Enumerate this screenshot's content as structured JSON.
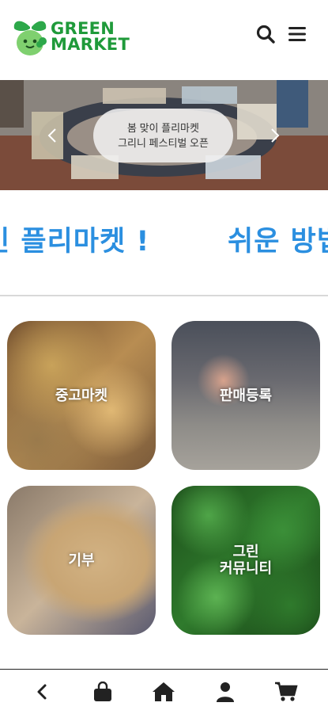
{
  "header": {
    "logo_line1": "GREEN",
    "logo_line2": "MARKET",
    "icons": [
      "search-icon",
      "menu-icon"
    ]
  },
  "banner": {
    "caption_line1": "봄 맞이 플리마켓",
    "caption_line2": "그리니 페스티벌 오픈"
  },
  "marquee": {
    "text1": "인 플리마켓 !",
    "text2": "쉬운 방법"
  },
  "tiles": [
    {
      "label": "중고마켓"
    },
    {
      "label": "판매등록"
    },
    {
      "label": "기부"
    },
    {
      "label": "그린\n커뮤니티"
    }
  ],
  "bottom_nav": [
    "back-icon",
    "shopping-bag-icon",
    "home-icon",
    "user-icon",
    "cart-icon"
  ],
  "colors": {
    "brand_green": "#1f9a3a",
    "marquee_blue": "#2b8fe0"
  }
}
